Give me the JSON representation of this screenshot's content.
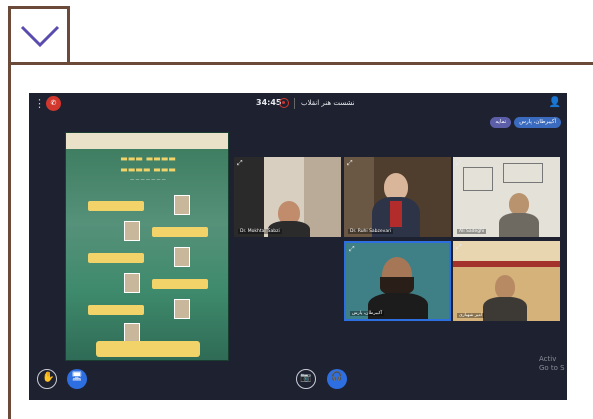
{
  "meeting": {
    "timer": "34:45",
    "session_title": "نشست هنر انقلاب",
    "badge_icon": "phone-end-icon",
    "chips": [
      "نمایه",
      "آکیبرطان، پارس"
    ]
  },
  "participants": [
    {
      "name": "Dr. Mokhtar Sabzi"
    },
    {
      "name": "Dr. Ruhi Sabzevari"
    },
    {
      "name": "Ali Sadeghi"
    },
    {
      "name": "آکیبرطان، پارس"
    },
    {
      "name": "امیر شهبازی"
    }
  ],
  "watermark": {
    "line1": "Activ",
    "line2": "Go to S"
  },
  "colors": {
    "frame_border": "#6b4a3a",
    "meeting_bg": "#1e2230",
    "accent_red": "#d2372e",
    "accent_blue": "#3b6bbf"
  }
}
